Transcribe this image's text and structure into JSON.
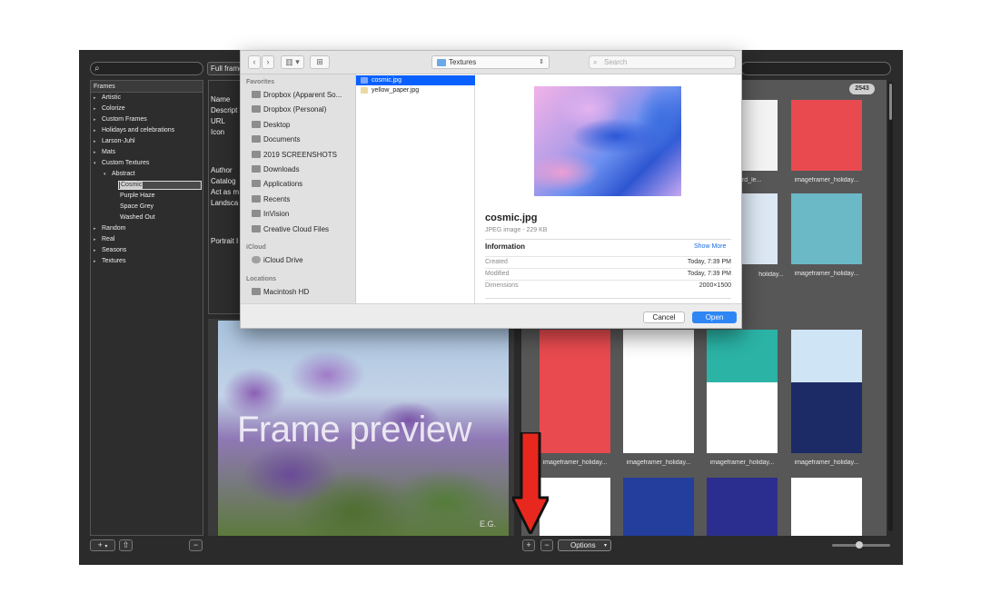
{
  "app": {
    "search_placeholder": "",
    "full_frame_label": "Full frame",
    "count_badge": "2543",
    "tree_header": "Frames",
    "tree_items": [
      {
        "label": "Artistic",
        "level": 0,
        "arrow": "▸"
      },
      {
        "label": "Colorize",
        "level": 0,
        "arrow": "▸"
      },
      {
        "label": "Custom Frames",
        "level": 0,
        "arrow": "▸"
      },
      {
        "label": "Holidays and celebrations",
        "level": 0,
        "arrow": "▸"
      },
      {
        "label": "Larson-Juhl",
        "level": 0,
        "arrow": "▸"
      },
      {
        "label": "Mats",
        "level": 0,
        "arrow": "▸"
      },
      {
        "label": "Custom Textures",
        "level": 0,
        "arrow": "▾"
      },
      {
        "label": "Abstract",
        "level": 1,
        "arrow": "▾"
      },
      {
        "label": "Cosmic",
        "level": 2,
        "arrow": "",
        "selected": true
      },
      {
        "label": "Purple Haze",
        "level": 2,
        "arrow": ""
      },
      {
        "label": "Space Grey",
        "level": 2,
        "arrow": ""
      },
      {
        "label": "Washed Out",
        "level": 2,
        "arrow": ""
      },
      {
        "label": "Random",
        "level": 0,
        "arrow": "▸"
      },
      {
        "label": "Real",
        "level": 0,
        "arrow": "▸"
      },
      {
        "label": "Seasons",
        "level": 0,
        "arrow": "▸"
      },
      {
        "label": "Textures",
        "level": 0,
        "arrow": "▸"
      }
    ],
    "detail_labels": [
      "Name",
      "Descript",
      "URL",
      "Icon",
      "Author",
      "Catalog",
      "Act as m",
      "Landsca",
      "Portrait I"
    ],
    "preview_text": "Frame preview",
    "preview_signature": "E.G.",
    "tiles": [
      {
        "caption": "",
        "kind": "bird"
      },
      {
        "caption": "imageframer_holiday...",
        "kind": "redframe"
      },
      {
        "caption": "",
        "kind": "partial"
      },
      {
        "caption": "",
        "kind": "partial"
      },
      {
        "caption": "",
        "kind": "partial"
      },
      {
        "caption": "imageframer_holiday...",
        "kind": "tree"
      },
      {
        "caption": "imageframer_holiday...",
        "kind": "red"
      },
      {
        "caption": "imageframer_holiday...",
        "kind": "happy"
      },
      {
        "caption": "imageframer_holiday...",
        "kind": "globe"
      },
      {
        "caption": "imageframer_holiday...",
        "kind": "ice"
      },
      {
        "caption": "imageframer_holiday...",
        "kind": "tree2"
      },
      {
        "caption": "imageframer_holiday...",
        "kind": "candy"
      },
      {
        "caption": "imageframer_holiday...",
        "kind": "snowflake"
      },
      {
        "caption": "imageframer_holiday...",
        "kind": "navy"
      },
      {
        "caption": "",
        "kind": "white"
      },
      {
        "caption": "",
        "kind": "blue"
      },
      {
        "caption": "",
        "kind": "gift"
      },
      {
        "caption": "",
        "kind": "ornament"
      }
    ],
    "partial_captions": [
      "_bird_le...",
      "holiday...",
      "holiday..."
    ],
    "bottom": {
      "add_label": "+",
      "dropdown_label": "▾",
      "share_label": "⇧",
      "remove_label": "−",
      "grid_add": "+",
      "grid_remove": "−",
      "options_label": "Options"
    }
  },
  "dialog": {
    "back": "‹",
    "forward": "›",
    "view_mode": "▥ ▾",
    "new_folder": "⊞",
    "path": "Textures",
    "search_placeholder": "Search",
    "sidebar": {
      "favorites_header": "Favorites",
      "favorites": [
        "Dropbox (Apparent So...",
        "Dropbox (Personal)",
        "Desktop",
        "Documents",
        "2019 SCREENSHOTS",
        "Downloads",
        "Applications",
        "Recents",
        "InVision",
        "Creative Cloud Files"
      ],
      "icloud_header": "iCloud",
      "icloud": [
        "iCloud Drive"
      ],
      "locations_header": "Locations",
      "locations": [
        "Macintosh HD"
      ]
    },
    "files": [
      {
        "name": "cosmic.jpg",
        "selected": true
      },
      {
        "name": "yellow_paper.jpg",
        "selected": false
      }
    ],
    "info": {
      "title": "cosmic.jpg",
      "subtitle": "JPEG image - 229 KB",
      "header": "Information",
      "show_more": "Show More",
      "rows": [
        {
          "key": "Created",
          "value": "Today, 7:39 PM"
        },
        {
          "key": "Modified",
          "value": "Today, 7:39 PM"
        },
        {
          "key": "Dimensions",
          "value": "2000×1500"
        }
      ]
    },
    "cancel": "Cancel",
    "open": "Open"
  },
  "colors": {
    "accent": "#2e86f5",
    "selection": "#0a60ff",
    "arrow": "#e8281e"
  }
}
